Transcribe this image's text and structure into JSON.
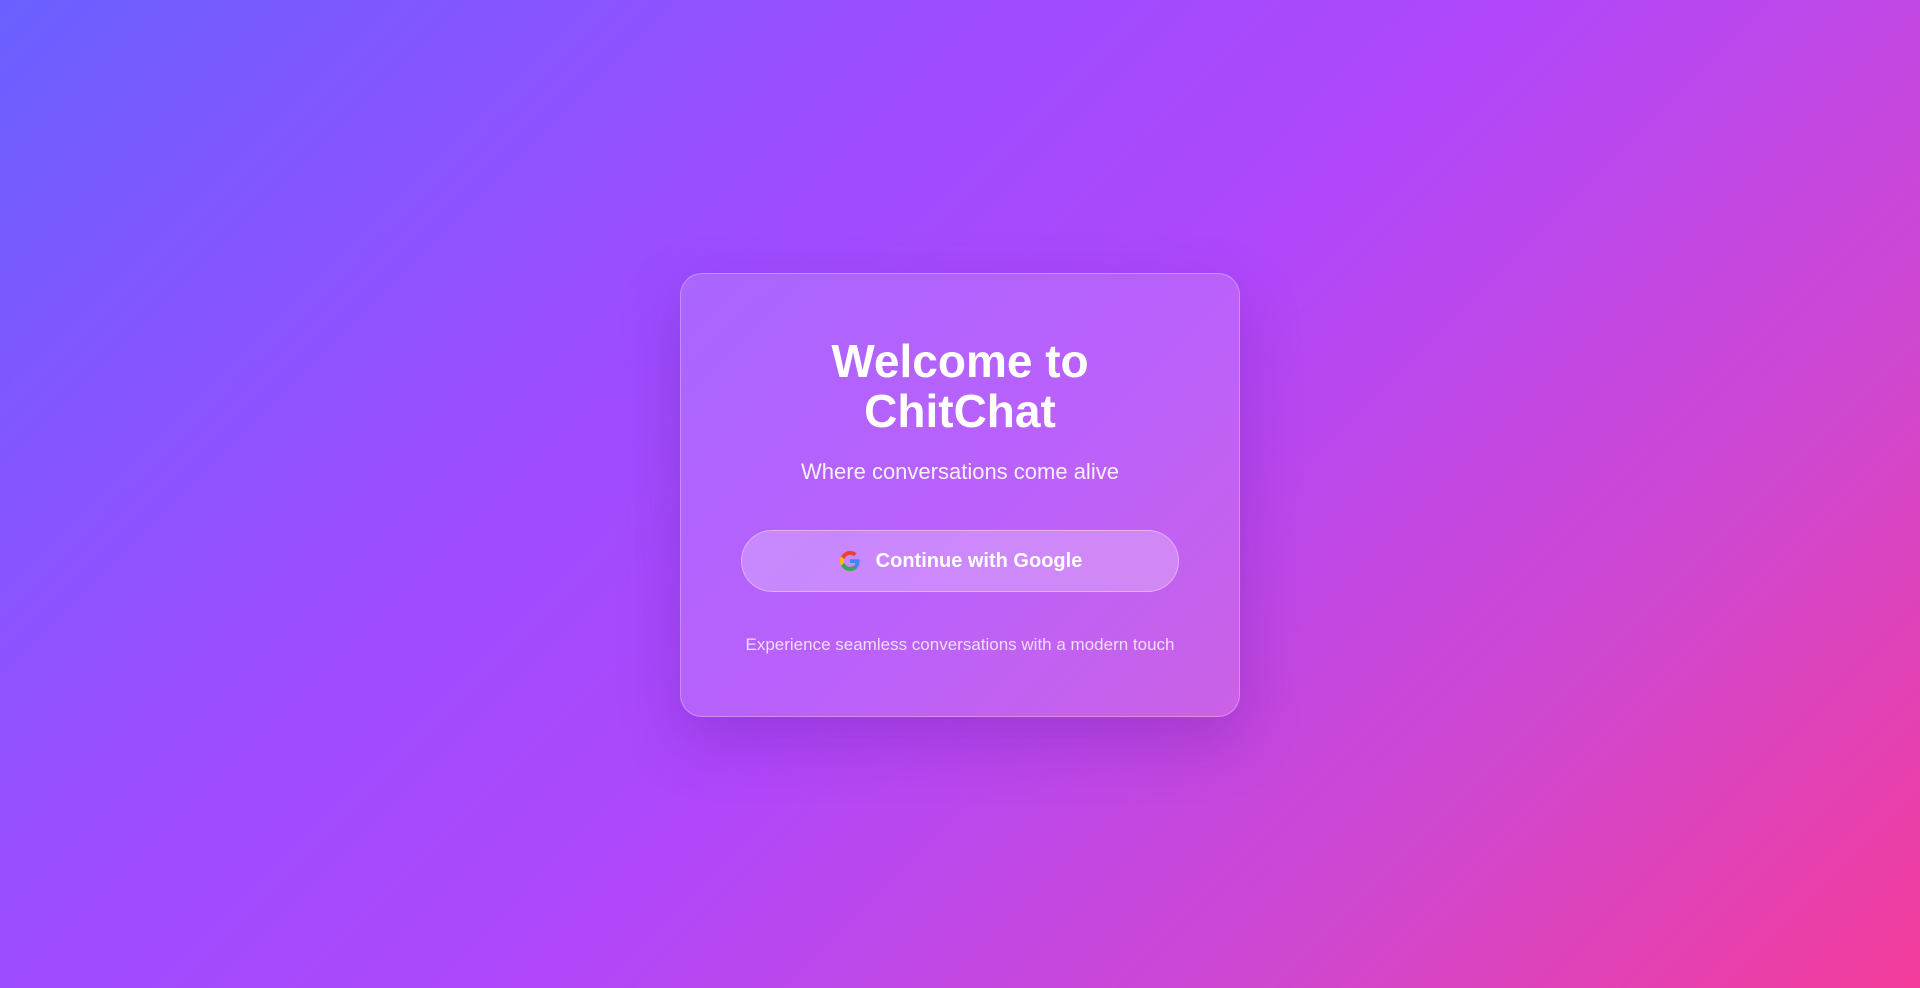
{
  "welcome": {
    "title": "Welcome to ChitChat",
    "subtitle": "Where conversations come alive",
    "google_button_label": "Continue with Google",
    "google_button_icon": "google-icon",
    "tagline": "Experience seamless conversations with a modern touch"
  },
  "colors": {
    "gradient_start": "#6a60ff",
    "gradient_mid": "#b047fb",
    "gradient_end": "#f43c9b"
  }
}
